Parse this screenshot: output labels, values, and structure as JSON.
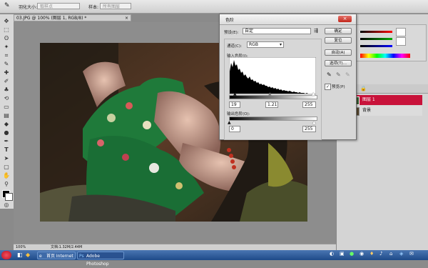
{
  "options_bar": {
    "feather_label": "羽化大小:",
    "feather_value": "取样点",
    "style_label": "样本:",
    "style_value": "所有图层"
  },
  "document": {
    "tab_title": "03.JPG @ 100% (图层 1, RGB/8) *",
    "close_glyph": "×",
    "zoom": "100%",
    "doc_info": "文档:1.32M/2.44M"
  },
  "levels_dialog": {
    "title": "色阶",
    "preset_label": "预设(E):",
    "preset_value": "自定",
    "channel_label": "通道(C):",
    "channel_value": "RGB",
    "input_levels_label": "输入色阶(I):",
    "input_black": "19",
    "input_gamma": "1.21",
    "input_white": "255",
    "output_levels_label": "输出色阶(O):",
    "output_black": "0",
    "output_white": "255",
    "buttons": {
      "ok": "确定",
      "cancel": "复位",
      "auto": "自动(A)",
      "options": "选项(T)..."
    },
    "preview_label": "预览(P)",
    "preview_checked": true
  },
  "layers_panel": {
    "layers": [
      {
        "name": "图层 1",
        "selected": true
      },
      {
        "name": "背景",
        "selected": false
      }
    ]
  },
  "taskbar": {
    "items": [
      {
        "label": "首页 Internet",
        "icon": "ie-icon"
      },
      {
        "label": "Adobe Photoshop",
        "icon": "photoshop-icon"
      }
    ]
  },
  "tools": [
    "move",
    "marquee",
    "lasso",
    "quick-select",
    "crop",
    "eyedropper",
    "healing",
    "brush",
    "clone",
    "history-brush",
    "eraser",
    "gradient",
    "blur",
    "dodge",
    "pen",
    "type",
    "path-select",
    "shape",
    "hand",
    "zoom"
  ]
}
